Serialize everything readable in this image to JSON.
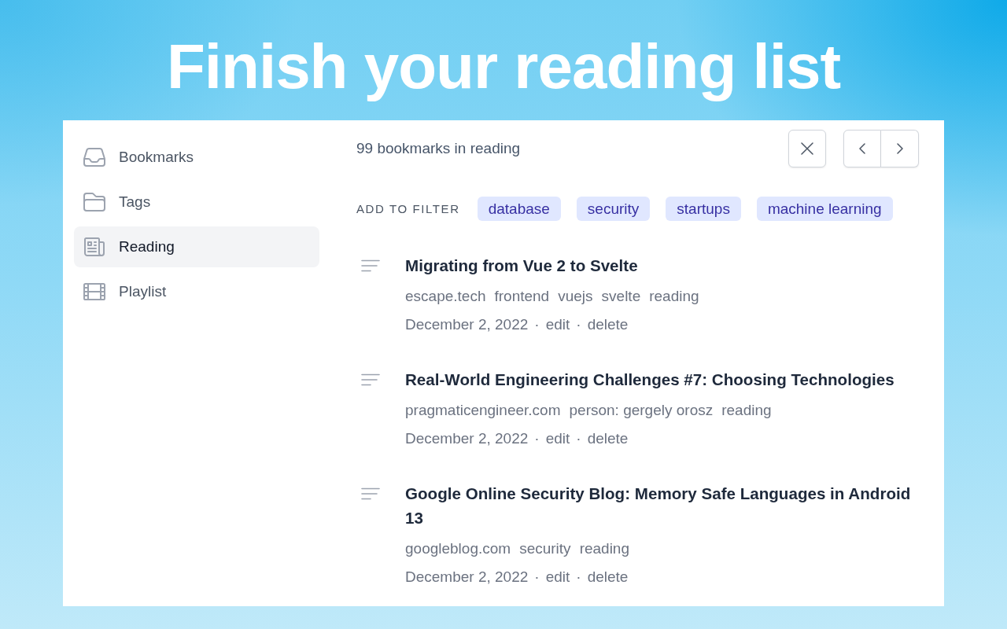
{
  "headline": "Finish your reading list",
  "sidebar": {
    "items": [
      {
        "label": "Bookmarks",
        "selected": false
      },
      {
        "label": "Tags",
        "selected": false
      },
      {
        "label": "Reading",
        "selected": true
      },
      {
        "label": "Playlist",
        "selected": false
      }
    ]
  },
  "header": {
    "count_text": "99 bookmarks in reading"
  },
  "filter": {
    "label": "ADD TO FILTER",
    "tags": [
      "database",
      "security",
      "startups",
      "machine learning"
    ]
  },
  "bookmarks": [
    {
      "title": "Migrating from Vue 2 to Svelte",
      "domain": "escape.tech",
      "tags": [
        "frontend",
        "vuejs",
        "svelte",
        "reading"
      ],
      "date": "December 2, 2022",
      "actions": [
        {
          "separator": "·",
          "label": "edit"
        },
        {
          "separator": "·",
          "label": "delete"
        }
      ]
    },
    {
      "title": "Real-World Engineering Challenges #7: Choosing Technologies",
      "domain": "pragmaticengineer.com",
      "tags": [
        "person: gergely orosz",
        "reading"
      ],
      "date": "December 2, 2022",
      "actions": [
        {
          "separator": "·",
          "label": "edit"
        },
        {
          "separator": "·",
          "label": "delete"
        }
      ]
    },
    {
      "title": "Google Online Security Blog: Memory Safe Languages in Android 13",
      "domain": "googleblog.com",
      "tags": [
        "security",
        "reading"
      ],
      "date": "December 2, 2022",
      "actions": [
        {
          "separator": "·",
          "label": "edit"
        },
        {
          "separator": "·",
          "label": "delete"
        }
      ]
    }
  ]
}
